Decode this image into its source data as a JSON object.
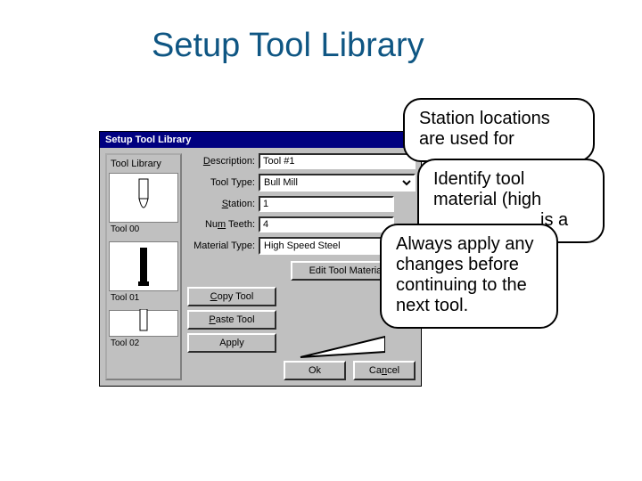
{
  "slide": {
    "title": "Setup Tool Library"
  },
  "dialog": {
    "title": "Setup Tool Library",
    "panel_label": "Tool Library",
    "tools": [
      {
        "caption": "Tool 00"
      },
      {
        "caption": "Tool 01"
      },
      {
        "caption": "Tool 02"
      }
    ],
    "form": {
      "description_label": "Description:",
      "description_value": "Tool #1",
      "tooltype_label": "Tool Type:",
      "tooltype_value": "Bull Mill",
      "station_label": "Station:",
      "station_value": "1",
      "numteeth_label": "Num Teeth:",
      "numteeth_value": "4",
      "material_label": "Material Type:",
      "material_value": "High Speed Steel"
    },
    "buttons": {
      "edit_materials": "Edit Tool Materials...",
      "copy": "Copy Tool",
      "paste": "Paste Tool",
      "apply": "Apply",
      "ok": "Ok",
      "cancel": "Cancel"
    }
  },
  "callouts": {
    "c1": "Station locations are used for",
    "c2_line1": "Identify tool",
    "c2_line2": "material (high",
    "c2_line3_partial": "is a",
    "c3": "Always apply any changes before continuing to the next tool."
  }
}
